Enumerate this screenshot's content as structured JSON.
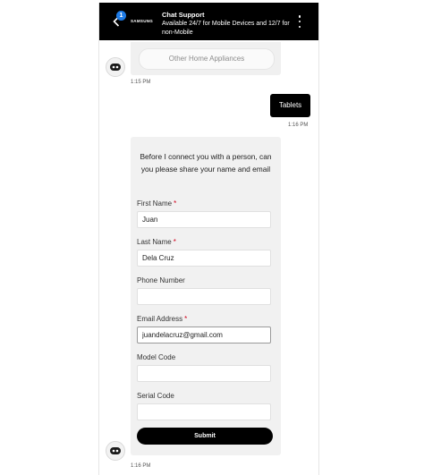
{
  "header": {
    "brand": "SAMSUNG",
    "unread_count": "1",
    "title": "Chat Support",
    "subtitle": "Available 24/7 for Mobile Devices and 12/7 for non-Mobile"
  },
  "messages": {
    "appliance_option": "Other Home Appliances",
    "bot_time_1": "1:15 PM",
    "user_message": "Tablets",
    "user_time": "1:16 PM",
    "bot_time_2": "1:16 PM"
  },
  "form": {
    "intro": "Before I connect you with a person, can you please share your name and email",
    "fields": [
      {
        "label": "First Name",
        "required": "*",
        "value": "Juan"
      },
      {
        "label": "Last Name",
        "required": "*",
        "value": "Dela Cruz"
      },
      {
        "label": "Phone Number",
        "required": "",
        "value": ""
      },
      {
        "label": "Email Address",
        "required": "*",
        "value": "juandelacruz@gmail.com"
      },
      {
        "label": "Model Code",
        "required": "",
        "value": ""
      },
      {
        "label": "Serial Code",
        "required": "",
        "value": ""
      }
    ],
    "submit_label": "Submit"
  },
  "colors": {
    "header_bg": "#000000",
    "badge": "#1e7be6",
    "required": "#d0021b",
    "submit_bg": "#000000"
  },
  "icons": [
    "back-chevron-icon",
    "kebab-menu-icon",
    "bot-avatar-icon"
  ]
}
